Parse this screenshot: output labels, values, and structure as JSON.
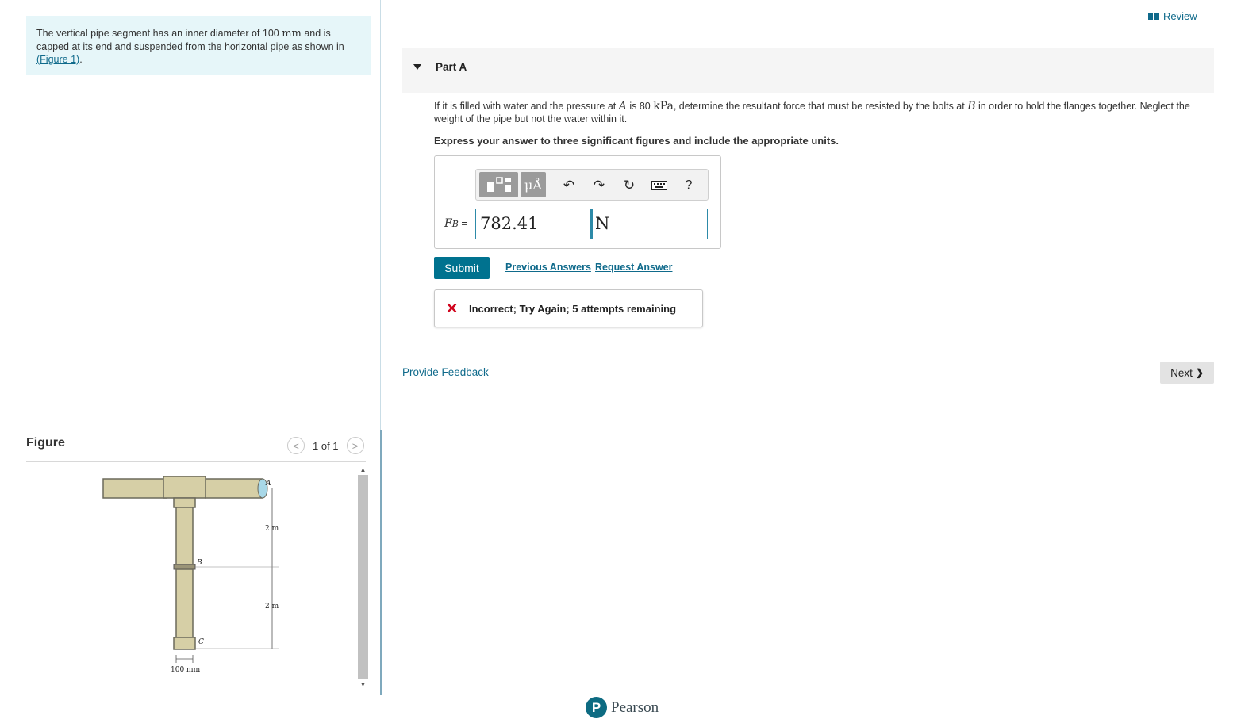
{
  "problem": {
    "text_before": "The vertical pipe segment has an inner diameter of 100 ",
    "unit": "mm",
    "text_after": " and is capped at its end and suspended from the horizontal pipe as shown in ",
    "figure_link": "(Figure 1)",
    "end": "."
  },
  "review": {
    "label": "Review"
  },
  "part": {
    "title": "Part A"
  },
  "question": {
    "t1": "If it is filled with water and the pressure at ",
    "var_a": "A",
    "t2": " is 80 ",
    "unit_kpa": "kPa",
    "t3": ", determine the resultant force that must be resisted by the bolts at ",
    "var_b": "B",
    "t4": " in order to hold the flanges together. Neglect the weight of the pipe but not the water within it."
  },
  "instruction": "Express your answer to three significant figures and include the appropriate units.",
  "toolbar": {
    "templates_icon": "templates-icon",
    "symbols_label": "μÅ",
    "undo_icon": "↶",
    "redo_icon": "↷",
    "reset_icon": "↻",
    "keyboard_icon": "keyboard-icon",
    "help_label": "?"
  },
  "answer": {
    "var_symbol": "F",
    "var_subscript": "B",
    "equals": " =",
    "value": "782.41",
    "unit": "N"
  },
  "actions": {
    "submit": "Submit",
    "previous_answers": "Previous Answers",
    "request_answer": "Request Answer"
  },
  "feedback": {
    "icon": "✕",
    "message": "Incorrect; Try Again; 5 attempts remaining"
  },
  "footer": {
    "provide_feedback": "Provide Feedback",
    "next_label": "Next",
    "next_icon": "❯",
    "brand_letter": "P",
    "brand": "Pearson"
  },
  "figure": {
    "title": "Figure",
    "counter": "1 of 1",
    "prev_icon": "<",
    "next_icon": ">",
    "labels": {
      "a": "A",
      "b": "B",
      "c": "C",
      "upper_length": "2 m",
      "lower_length": "2 m",
      "diameter": "100 mm"
    }
  },
  "colors": {
    "accent": "#00728f",
    "link": "#0f6a8b",
    "problem_bg": "#e6f6f9",
    "error": "#d0021b",
    "pipe": "#d6cfa6"
  }
}
